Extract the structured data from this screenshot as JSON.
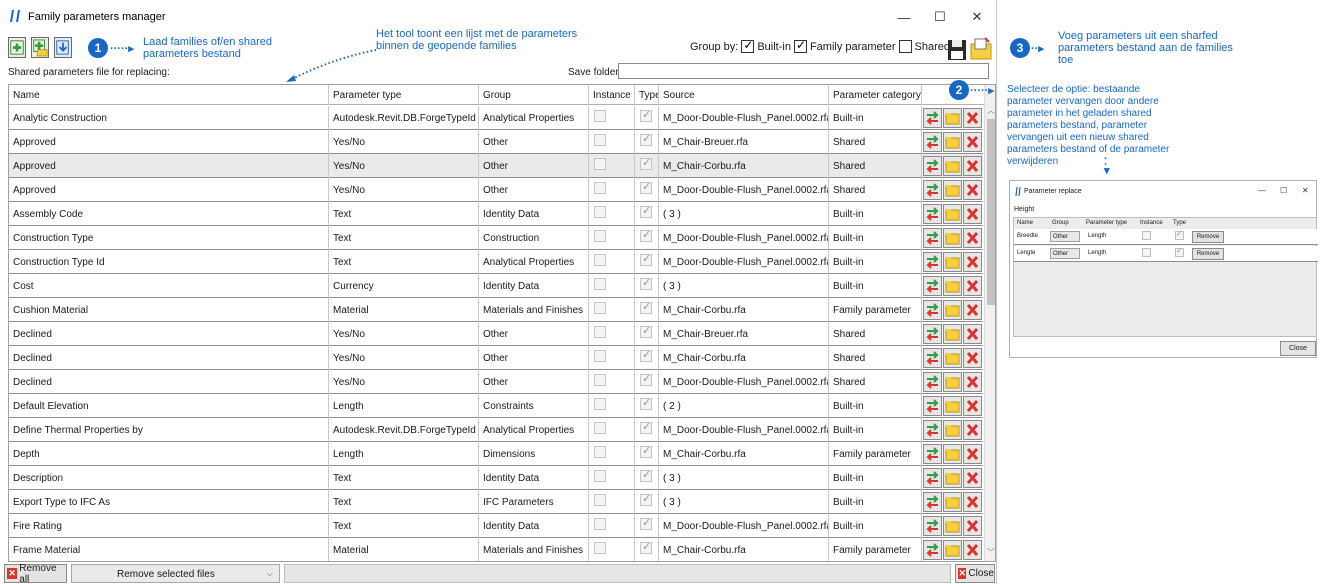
{
  "window": {
    "title": "Family parameters manager",
    "minimize_glyph": "—",
    "maximize_glyph": "☐",
    "close_glyph": "✕"
  },
  "toolbar": {
    "icons": [
      "add-family-icon",
      "add-folder-families-icon",
      "load-shared-params-icon"
    ]
  },
  "annotations": {
    "badge_1": "1",
    "note_1": "Laad families of/en shared parameters bestand",
    "note_top": "Het tool toont een lijst met de parameters binnen de geopende families",
    "badge_2": "2",
    "note_2": "Selecteer de optie: bestaande parameter vervangen door andere parameter in het geladen shared parameters bestand, parameter vervangen uit een nieuw shared parameters bestand of de parameter verwijderen",
    "badge_3": "3",
    "note_3": "Voeg parameters uit een sharfed parameters bestand aan de families toe"
  },
  "group_by": {
    "label": "Group by:",
    "builtin_label": "Built-in",
    "builtin_checked": true,
    "family_param_label": "Family parameter",
    "family_param_checked": true,
    "shared_label": "Shared",
    "shared_checked": false
  },
  "shared_file_label": "Shared parameters file for replacing:",
  "save_folder_label": "Save folder:",
  "save_folder_value": "",
  "grid": {
    "columns": [
      "Name",
      "Parameter type",
      "Group",
      "Instance",
      "Type",
      "Source",
      "Parameter category"
    ],
    "rows": [
      {
        "name": "Analytic Construction",
        "ptype": "Autodesk.Revit.DB.ForgeTypeId",
        "group": "Analytical Properties",
        "instance": false,
        "type": true,
        "source": "M_Door-Double-Flush_Panel.0002.rfa",
        "category": "Built-in"
      },
      {
        "name": "Approved",
        "ptype": "Yes/No",
        "group": "Other",
        "instance": false,
        "type": true,
        "source": "M_Chair-Breuer.rfa",
        "category": "Shared"
      },
      {
        "name": "Approved",
        "ptype": "Yes/No",
        "group": "Other",
        "instance": false,
        "type": true,
        "source": "M_Chair-Corbu.rfa",
        "category": "Shared"
      },
      {
        "name": "Approved",
        "ptype": "Yes/No",
        "group": "Other",
        "instance": false,
        "type": true,
        "source": "M_Door-Double-Flush_Panel.0002.rfa",
        "category": "Shared"
      },
      {
        "name": "Assembly Code",
        "ptype": "Text",
        "group": "Identity Data",
        "instance": false,
        "type": true,
        "source": "( 3 )",
        "category": "Built-in"
      },
      {
        "name": "Construction Type",
        "ptype": "Text",
        "group": "Construction",
        "instance": false,
        "type": true,
        "source": "M_Door-Double-Flush_Panel.0002.rfa",
        "category": "Built-in"
      },
      {
        "name": "Construction Type Id",
        "ptype": "Text",
        "group": "Analytical Properties",
        "instance": false,
        "type": true,
        "source": "M_Door-Double-Flush_Panel.0002.rfa",
        "category": "Built-in"
      },
      {
        "name": "Cost",
        "ptype": "Currency",
        "group": "Identity Data",
        "instance": false,
        "type": true,
        "source": "( 3 )",
        "category": "Built-in"
      },
      {
        "name": "Cushion Material",
        "ptype": "Material",
        "group": "Materials and Finishes",
        "instance": false,
        "type": true,
        "source": "M_Chair-Corbu.rfa",
        "category": "Family parameter"
      },
      {
        "name": "Declined",
        "ptype": "Yes/No",
        "group": "Other",
        "instance": false,
        "type": true,
        "source": "M_Chair-Breuer.rfa",
        "category": "Shared"
      },
      {
        "name": "Declined",
        "ptype": "Yes/No",
        "group": "Other",
        "instance": false,
        "type": true,
        "source": "M_Chair-Corbu.rfa",
        "category": "Shared"
      },
      {
        "name": "Declined",
        "ptype": "Yes/No",
        "group": "Other",
        "instance": false,
        "type": true,
        "source": "M_Door-Double-Flush_Panel.0002.rfa",
        "category": "Shared"
      },
      {
        "name": "Default Elevation",
        "ptype": "Length",
        "group": "Constraints",
        "instance": false,
        "type": true,
        "source": "( 2 )",
        "category": "Built-in"
      },
      {
        "name": "Define Thermal Properties by",
        "ptype": "Autodesk.Revit.DB.ForgeTypeId",
        "group": "Analytical Properties",
        "instance": false,
        "type": true,
        "source": "M_Door-Double-Flush_Panel.0002.rfa",
        "category": "Built-in"
      },
      {
        "name": "Depth",
        "ptype": "Length",
        "group": "Dimensions",
        "instance": false,
        "type": true,
        "source": "M_Chair-Corbu.rfa",
        "category": "Family parameter"
      },
      {
        "name": "Description",
        "ptype": "Text",
        "group": "Identity Data",
        "instance": false,
        "type": true,
        "source": "( 3 )",
        "category": "Built-in"
      },
      {
        "name": "Export Type to IFC As",
        "ptype": "Text",
        "group": "IFC Parameters",
        "instance": false,
        "type": true,
        "source": "( 3 )",
        "category": "Built-in"
      },
      {
        "name": "Fire Rating",
        "ptype": "Text",
        "group": "Identity Data",
        "instance": false,
        "type": true,
        "source": "M_Door-Double-Flush_Panel.0002.rfa",
        "category": "Built-in"
      },
      {
        "name": "Frame Material",
        "ptype": "Material",
        "group": "Materials and Finishes",
        "instance": false,
        "type": true,
        "source": "M_Chair-Corbu.rfa",
        "category": "Family parameter"
      }
    ],
    "action_icons": [
      "replace-icon",
      "folder-icon",
      "delete-icon"
    ]
  },
  "bottom": {
    "remove_all_label": "Remove all",
    "remove_selected_label": "Remove selected files",
    "close_label": "Close"
  },
  "mini_dialog": {
    "title": "Parameter replace",
    "height_label": "Height",
    "columns": [
      "Name",
      "Group",
      "Parameter type",
      "Instance",
      "Type"
    ],
    "rows": [
      {
        "name": "Breedte",
        "group": "Other",
        "ptype": "Length",
        "instance": false,
        "type": true,
        "action": "Remove"
      },
      {
        "name": "Lengte",
        "group": "Other",
        "ptype": "Length",
        "instance": false,
        "type": true,
        "action": "Remove"
      }
    ],
    "close_label": "Close"
  },
  "colors": {
    "accent_blue": "#1668c6",
    "delete_red": "#d9342a",
    "folder_yellow": "#f4d03f",
    "replace_green": "#2f9e44"
  }
}
